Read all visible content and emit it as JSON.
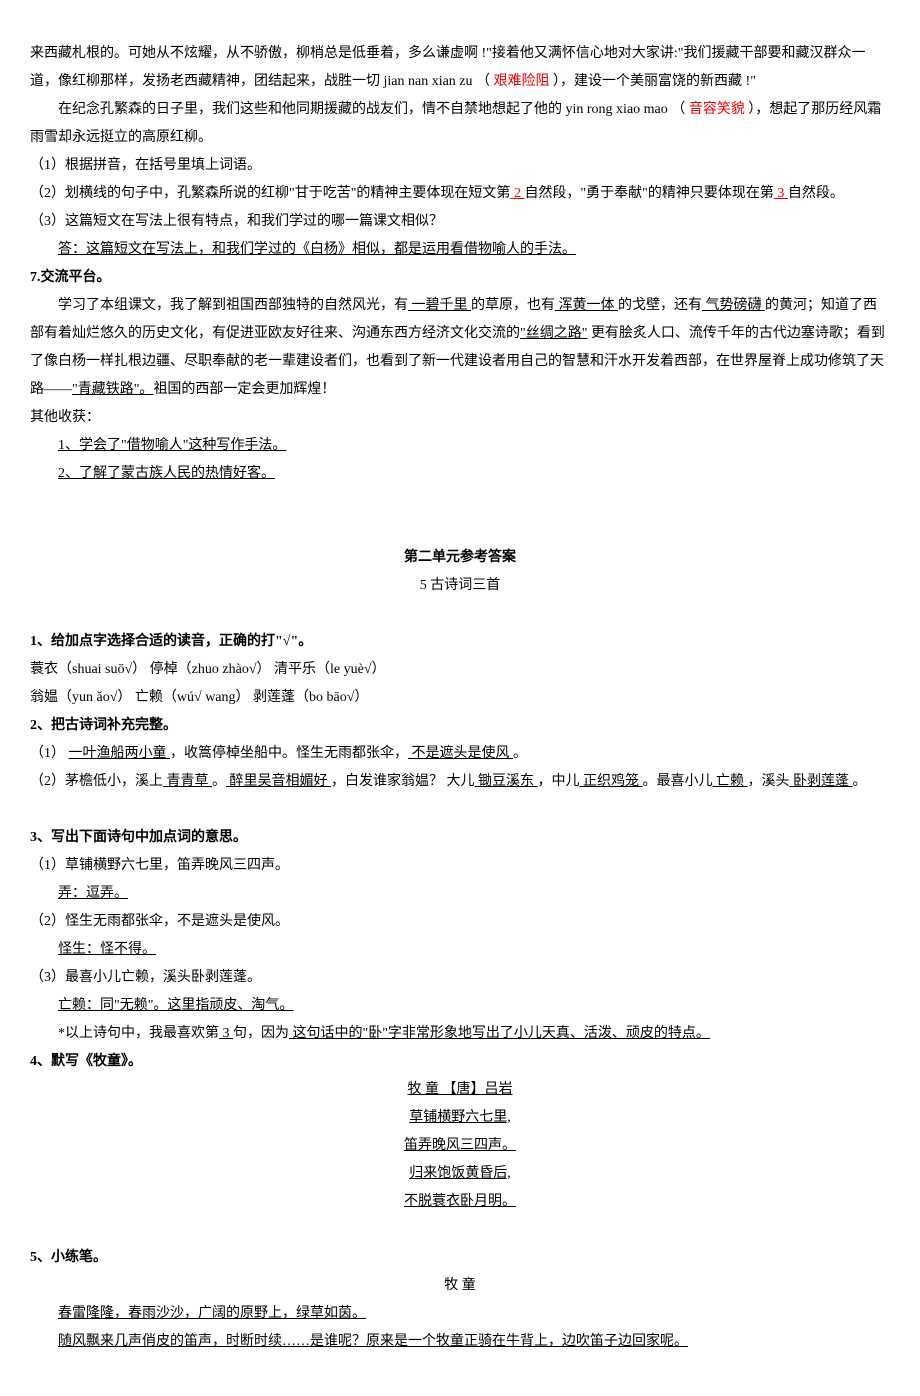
{
  "para1": {
    "t1": "来西藏札根的。可她从不炫耀，从不骄傲，柳梢总是低垂着，多么谦虚啊 !\"接着他又满怀信心地对大家讲:\"我们援藏干部要和藏汉群众一道，像红柳那样，发扬老西藏精神，团结起来，战胜一切 jian nan xian zu （ ",
    "red1": "艰难险阻",
    "t2": " ），建设一个美丽富饶的新西藏 !\""
  },
  "para2": {
    "t1": "在纪念孔繁森的日子里，我们这些和他同期援藏的战友们，情不自禁地想起了他的 yin rong xiao mao  （ ",
    "red1": "音容笑貌",
    "t2": " ），想起了那历经风霜雨雪却永远挺立的高原红柳。"
  },
  "q1": "（1）根据拼音，在括号里填上词语。",
  "q2": {
    "t1": "（2）划横线的句子中，孔繁森所说的红柳\"甘于吃苦\"的精神主要体现在短文第",
    "u1": " 2 ",
    "t2": "自然段，\"勇于奉献\"的精神只要体现在第",
    "u2": " 3 ",
    "t3": "自然段。"
  },
  "q3": "（3）这篇短文在写法上很有特点，和我们学过的哪一篇课文相似？",
  "q3a": "答：这篇短文在写法上，和我们学过的《白杨》相似，都是运用看借物喻人的手法。",
  "h7": "7.交流平台。",
  "p7": {
    "t1": "学习了本组课文，我了解到祖国西部独特的自然风光，有",
    "u1": " 一碧千里 ",
    "t2": "的草原，也有",
    "u2": " 浑黄一体 ",
    "t3": "的戈壁，还有",
    "u3": " 气势磅礴 ",
    "t4": "的黄河；知道了西部有着灿烂悠久的历史文化，有促进亚欧友好往来、沟通东西方经济文化交流的",
    "u4": "\"丝绸之路\"",
    "t5": " 更有脍炙人口、流传千年的古代边塞诗歌；看到了像白杨一样扎根边疆、尽职奉献的老一辈建设者们，也看到了新一代建设者用自己的智慧和汗水开发着西部，在世界屋脊上成功修筑了天路——",
    "u5": "\"青藏铁路\"。",
    "t6": "祖国的西部一定会更加辉煌！"
  },
  "other": "其他收获：",
  "other1": "1、学会了\"借物喻人\"这种写作手法。",
  "other2": "2、了解了蒙古族人民的热情好客。",
  "unit2title": "第二单元参考答案",
  "unit2sub": "5   古诗词三首",
  "s1h": "1、给加点字选择合适的读音，正确的打\"√\"。",
  "s1l1": "蓑衣（shuai   suō√）  停棹（zhuo   zhào√）   清平乐（le   yuè√）",
  "s1l2": "翁媪（yun   ǎo√）      亡赖（wú√   wang）  剥莲蓬（bo   bāo√）",
  "s2h": "2、把古诗词补充完整。",
  "s2_1": {
    "t1": "（1） ",
    "u1": "  一叶渔船两小童  ",
    "t2": "，收篙停棹坐船中。怪生无雨都张伞，",
    "u2": " 不是遮头是使风 ",
    "t3": "。"
  },
  "s2_2": {
    "t1": "（2）茅檐低小，溪上",
    "u1": " 青青草 ",
    "t2": "。",
    "u2": " 醉里吴音相媚好 ",
    "t3": "，白发谁家翁媪？    大儿",
    "u3": " 锄豆溪东 ",
    "t4": "，中儿",
    "u4": " 正织鸡笼 ",
    "t5": "。最喜小儿",
    "u5": " 亡赖 ",
    "t6": "，溪头",
    "u6": " 卧剥莲蓬 ",
    "t7": "。"
  },
  "s3h": "3、写出下面诗句中加点词的意思。",
  "s3_1": "（1）草铺横野六七里，笛弄晚风三四声。",
  "s3_1a": "弄：逗弄。",
  "s3_2": "（2）怪生无雨都张伞，不是遮头是使风。",
  "s3_2a": "怪生：怪不得。",
  "s3_3": "（3）最喜小儿亡赖，溪头卧剥莲蓬。",
  "s3_3a": "亡赖：同\"无赖\"。这里指顽皮、淘气。",
  "s3_4": {
    "t1": "*以上诗句中，我最喜欢第",
    "u1": " 3 ",
    "t2": "句，因为",
    "u2": " 这句话中的\"卧\"字非常形象地写出了小儿天真、活泼、顽皮的特点。"
  },
  "s4h": "4、默写《牧童》。",
  "poem": {
    "l1": "         牧  童   【唐】吕岩   ",
    "l2": "     草铺横野六七里,      ",
    "l3": "     笛弄晚风三四声。     ",
    "l4": "     归来饱饭黄昏后,      ",
    "l5": "     不脱蓑衣卧月明。     "
  },
  "s5h": "5、小练笔。",
  "s5title": "牧  童",
  "s5_1": "春雷隆隆，春雨沙沙，广阔的原野上，绿草如茵。",
  "s5_2": "随风飘来几声俏皮的笛声，时断时续……是谁呢？原来是一个牧童正骑在牛背上，边吹笛子边回家呢。"
}
